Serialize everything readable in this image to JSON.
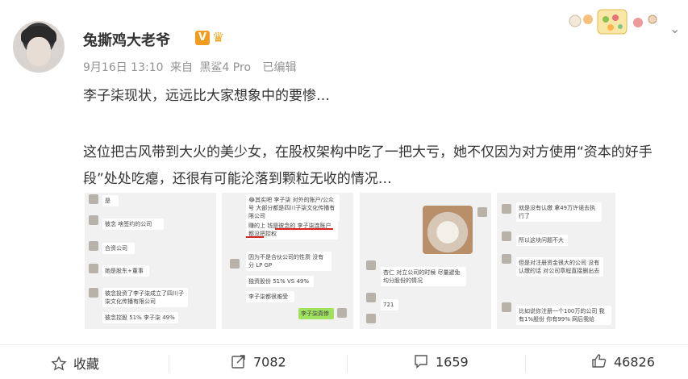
{
  "post": {
    "author": "兔撕鸡大老爷",
    "badge_v": "V",
    "date": "9月16日 13:10",
    "source_prefix": "来自",
    "source": "黑鲨4 Pro",
    "edited": "已编辑",
    "line1": "李子柒现状，远远比大家想象中的要惨…",
    "line2": "这位把古风带到大火的美少女，在股权架构中吃了一把大亏，她不仅因为对方使用“资本的好手段”处处吃瘪，还很有可能沦落到颗粒无收的情况…"
  },
  "images": [
    {
      "bubbles": [
        "是",
        "彼念 啥签约的公司",
        "合资公司",
        "她是股东+董事",
        "彼念投资了李子柒成立了四川子柒文化传播有限公司",
        "彼念控股 51% 李子柒 49%"
      ]
    },
    {
      "bubbles": [
        "😂其实吧 李子柒 对外的账户/公众号 大部分都是四川子柒文化传播有限公司",
        "赚的上 钱是彼念的 李子柒连账户都没把控权",
        "因为不是合伙公司的性质 没有分 LP GP",
        "独资股份 51% VS 49%",
        "李子柒都很难受",
        "李子柒真惨"
      ]
    },
    {
      "bubbles": [
        "杏仁 对立公司的时候 尽量避免均分股份的情况",
        "721"
      ]
    },
    {
      "bubbles": [
        "就是没有认缴 拿49万许诺去执行了",
        "所以这块问题不大",
        "但是对注册资金很大的公司 没有认缴的话 对公司章程直接删出去",
        "比如说你注册一个100万的公司 我有1%股份 你有99%  网后我给"
      ]
    }
  ],
  "actions": {
    "favorite": "收藏",
    "repost": "7082",
    "comment": "1659",
    "like": "46826"
  }
}
